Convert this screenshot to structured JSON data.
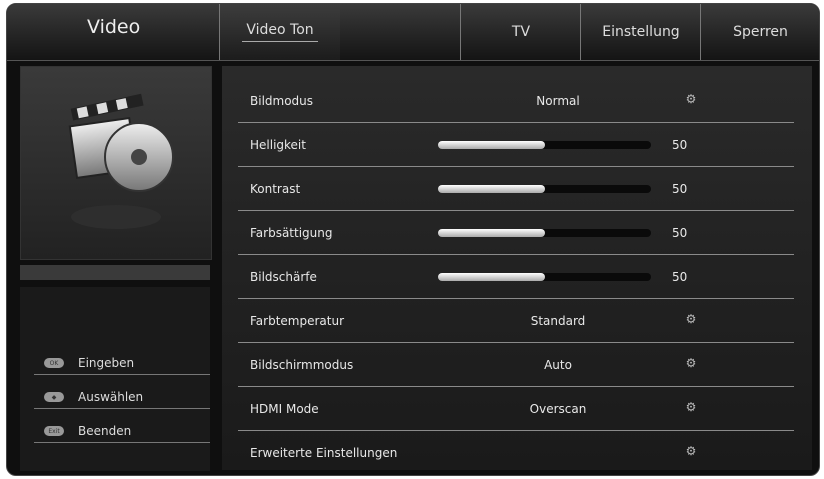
{
  "header": {
    "title": "Video",
    "tabs": [
      "Video Ton",
      "TV",
      "Einstellung",
      "Sperren"
    ]
  },
  "hints": [
    {
      "key": "OK",
      "label": "Eingeben"
    },
    {
      "key": "◆",
      "label": "Auswählen"
    },
    {
      "key": "Exit",
      "label": "Beenden"
    }
  ],
  "settings": [
    {
      "label": "Bildmodus",
      "value": "Normal"
    },
    {
      "label": "Helligkeit",
      "slider": 50,
      "value": "50"
    },
    {
      "label": "Kontrast",
      "slider": 50,
      "value": "50"
    },
    {
      "label": "Farbsättigung",
      "slider": 50,
      "value": "50"
    },
    {
      "label": "Bildschärfe",
      "slider": 50,
      "value": "50"
    },
    {
      "label": "Farbtemperatur",
      "value": "Standard"
    },
    {
      "label": "Bildschirmmodus",
      "value": "Auto"
    },
    {
      "label": "HDMI Mode",
      "value": "Overscan"
    },
    {
      "label": "Erweiterte Einstellungen",
      "value": ""
    }
  ],
  "icons": {
    "category": "video-clapper-icon",
    "row_action": "gear-icon"
  }
}
